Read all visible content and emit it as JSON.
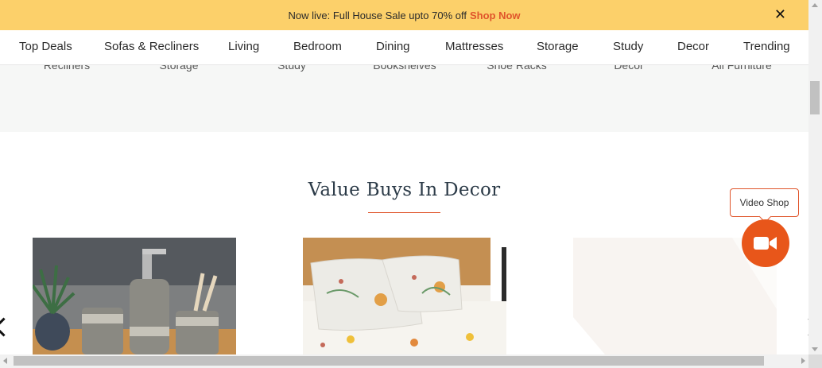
{
  "banner": {
    "text": "Now live: Full House Sale upto 70% off",
    "link": "Shop Now",
    "close": "✕",
    "bg_color": "#fcd06a",
    "link_color": "#e0552b"
  },
  "nav": {
    "items": [
      "Top Deals",
      "Sofas & Recliners",
      "Living",
      "Bedroom",
      "Dining",
      "Mattresses",
      "Storage",
      "Study",
      "Decor",
      "Trending"
    ]
  },
  "categories": {
    "labels": [
      "Recliners",
      "Storage",
      "Study",
      "Bookshelves",
      "Shoe Racks",
      "Decor",
      "All Furniture"
    ]
  },
  "section": {
    "title": "Value Buys In Decor",
    "accent_color": "#e0552b"
  },
  "products": [
    {
      "icon": "bathroom-accessory-set-image"
    },
    {
      "icon": "floral-bedsheet-image"
    },
    {
      "icon": "rug-image"
    }
  ],
  "video_shop": {
    "label": "Video Shop",
    "icon": "video-camera-icon",
    "color": "#e8561a"
  }
}
